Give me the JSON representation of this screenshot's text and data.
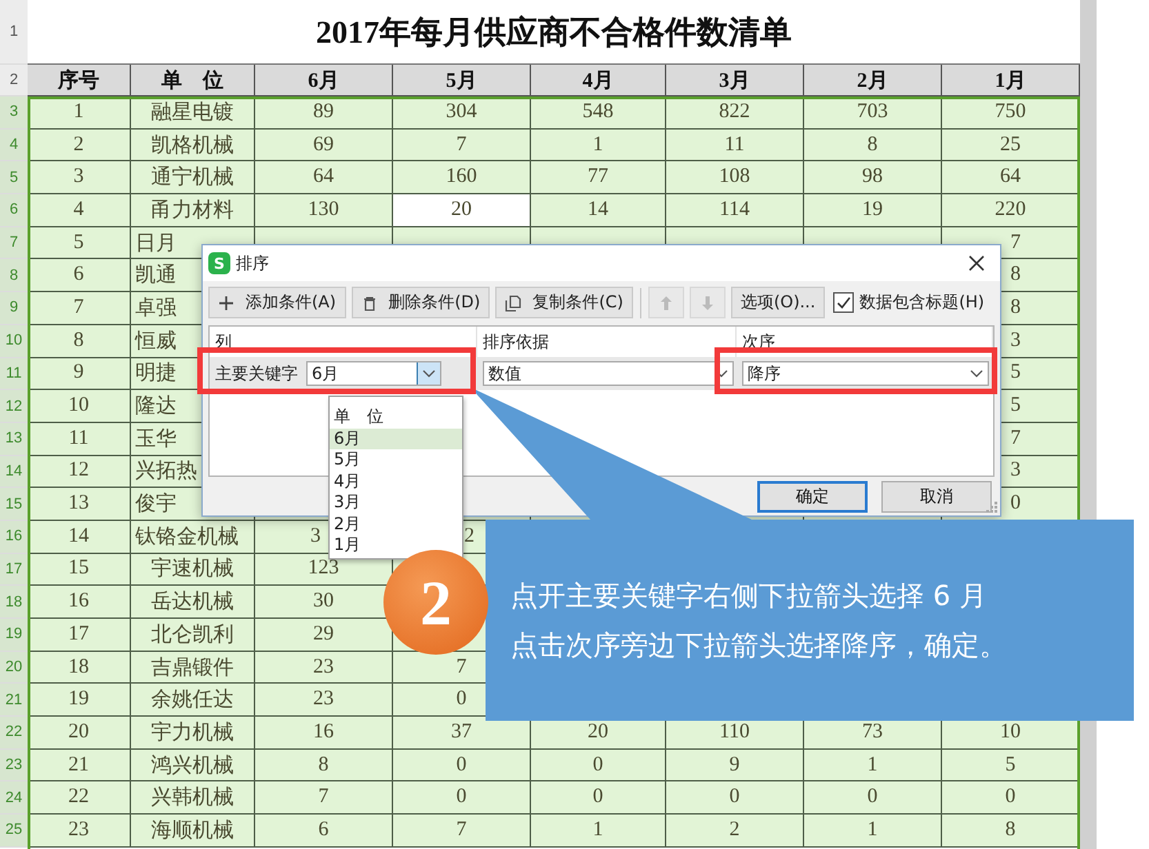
{
  "sheet": {
    "title": "2017年每月供应商不合格件数清单",
    "row_headers": [
      {
        "label": "1",
        "selected": false
      },
      {
        "label": "2",
        "selected": false
      },
      {
        "label": "3",
        "selected": true
      },
      {
        "label": "4",
        "selected": true
      },
      {
        "label": "5",
        "selected": true
      },
      {
        "label": "6",
        "selected": true
      },
      {
        "label": "7",
        "selected": true
      },
      {
        "label": "8",
        "selected": true
      },
      {
        "label": "9",
        "selected": true
      },
      {
        "label": "10",
        "selected": true
      },
      {
        "label": "11",
        "selected": true
      },
      {
        "label": "12",
        "selected": true
      },
      {
        "label": "13",
        "selected": true
      },
      {
        "label": "14",
        "selected": true
      },
      {
        "label": "15",
        "selected": true
      },
      {
        "label": "16",
        "selected": true
      },
      {
        "label": "17",
        "selected": true
      },
      {
        "label": "18",
        "selected": true
      },
      {
        "label": "19",
        "selected": true
      },
      {
        "label": "20",
        "selected": true
      },
      {
        "label": "21",
        "selected": true
      },
      {
        "label": "22",
        "selected": true
      },
      {
        "label": "23",
        "selected": true
      },
      {
        "label": "24",
        "selected": true
      },
      {
        "label": "25",
        "selected": true
      }
    ],
    "columns": [
      "序号",
      "单　位",
      "6月",
      "5月",
      "4月",
      "3月",
      "2月",
      "1月"
    ],
    "rows": [
      {
        "cells": [
          "1",
          "融星电镀",
          "89",
          "304",
          "548",
          "822",
          "703",
          "750"
        ]
      },
      {
        "cells": [
          "2",
          "凯格机械",
          "69",
          "7",
          "1",
          "11",
          "8",
          "25"
        ]
      },
      {
        "cells": [
          "3",
          "通宁机械",
          "64",
          "160",
          "77",
          "108",
          "98",
          "64"
        ]
      },
      {
        "cells": [
          {
            "text": "4",
            "selected": false
          },
          {
            "text": "甬力材料",
            "selected": false
          },
          {
            "text": "130",
            "selected": false
          },
          {
            "text": "20",
            "selected": true
          },
          {
            "text": "14",
            "selected": false
          },
          {
            "text": "114",
            "selected": false
          },
          {
            "text": "19",
            "selected": false
          },
          {
            "text": "220",
            "selected": false
          }
        ]
      },
      {
        "cells": [
          "5",
          "日月"
        ],
        "tail": [
          "7"
        ],
        "covered": true
      },
      {
        "cells": [
          "6",
          "凯通"
        ],
        "tail": [
          "8"
        ],
        "covered": true
      },
      {
        "cells": [
          "7",
          "卓强"
        ],
        "tail": [
          "8"
        ],
        "covered": true
      },
      {
        "cells": [
          "8",
          "恒威"
        ],
        "tail": [
          "3"
        ],
        "covered": true
      },
      {
        "cells": [
          "9",
          "明捷"
        ],
        "tail": [
          "5"
        ],
        "covered": true
      },
      {
        "cells": [
          "10",
          "隆达"
        ],
        "tail": [
          "5"
        ],
        "covered": true
      },
      {
        "cells": [
          "11",
          "玉华"
        ],
        "tail": [
          "7"
        ],
        "covered": true
      },
      {
        "cells": [
          "12",
          "兴拓热"
        ],
        "tail": [
          "3"
        ],
        "covered": true
      },
      {
        "cells": [
          "13",
          "俊宇"
        ],
        "tail": [
          "0"
        ],
        "covered": true
      },
      {
        "cells": [
          "14",
          "钛铬金机械",
          "3",
          "2"
        ],
        "covered": true
      },
      {
        "cells": [
          "15",
          "宇速机械",
          "123"
        ]
      },
      {
        "cells": [
          "16",
          "岳达机械",
          "30"
        ]
      },
      {
        "cells": [
          "17",
          "北仑凯利",
          "29"
        ]
      },
      {
        "cells": [
          "18",
          "吉鼎锻件",
          "23",
          "7"
        ]
      },
      {
        "cells": [
          "19",
          "余姚任达",
          "23",
          "0"
        ]
      },
      {
        "cells": [
          "20",
          "宇力机械",
          "16",
          "37",
          "20",
          "110",
          "73",
          "10"
        ]
      },
      {
        "cells": [
          "21",
          "鸿兴机械",
          "8",
          "0",
          "0",
          "9",
          "1",
          "5"
        ]
      },
      {
        "cells": [
          "22",
          "兴韩机械",
          "7",
          "0",
          "0",
          "0",
          "0",
          "0"
        ]
      },
      {
        "cells": [
          "23",
          "海顺机械",
          "6",
          "7",
          "1",
          "2",
          "1",
          "8"
        ]
      }
    ]
  },
  "dialog": {
    "icon_text": "S",
    "title": "排序",
    "toolbar": [
      {
        "kind": "add",
        "label": "添加条件(A)"
      },
      {
        "kind": "delete",
        "label": "删除条件(D)"
      },
      {
        "kind": "copy",
        "label": "复制条件(C)"
      },
      {
        "kind": "up",
        "disabled": true
      },
      {
        "kind": "down",
        "disabled": true
      },
      {
        "kind": "options",
        "label": "选项(O)..."
      }
    ],
    "header_checkbox": {
      "label": "数据包含标题(H)",
      "checked": true
    },
    "columns": [
      "列",
      "排序依据",
      "次序"
    ],
    "condition": {
      "label": "主要关键字",
      "column": "6月",
      "expanded": true,
      "basis": "数值",
      "order": "降序"
    },
    "dropdown": [
      {
        "label": "单　位",
        "selected": false
      },
      {
        "label": "6月",
        "selected": true
      },
      {
        "label": "5月",
        "selected": false
      },
      {
        "label": "4月",
        "selected": false
      },
      {
        "label": "3月",
        "selected": false
      },
      {
        "label": "2月",
        "selected": false
      },
      {
        "label": "1月",
        "selected": false
      }
    ],
    "buttons": [
      {
        "label": "确定",
        "default": true
      },
      {
        "label": "取消",
        "default": false
      }
    ]
  },
  "callout": {
    "step": "2",
    "lines": [
      "点开主要关键字右侧下拉箭头选择 6 月",
      "点击次序旁边下拉箭头选择降序，确定。"
    ]
  }
}
